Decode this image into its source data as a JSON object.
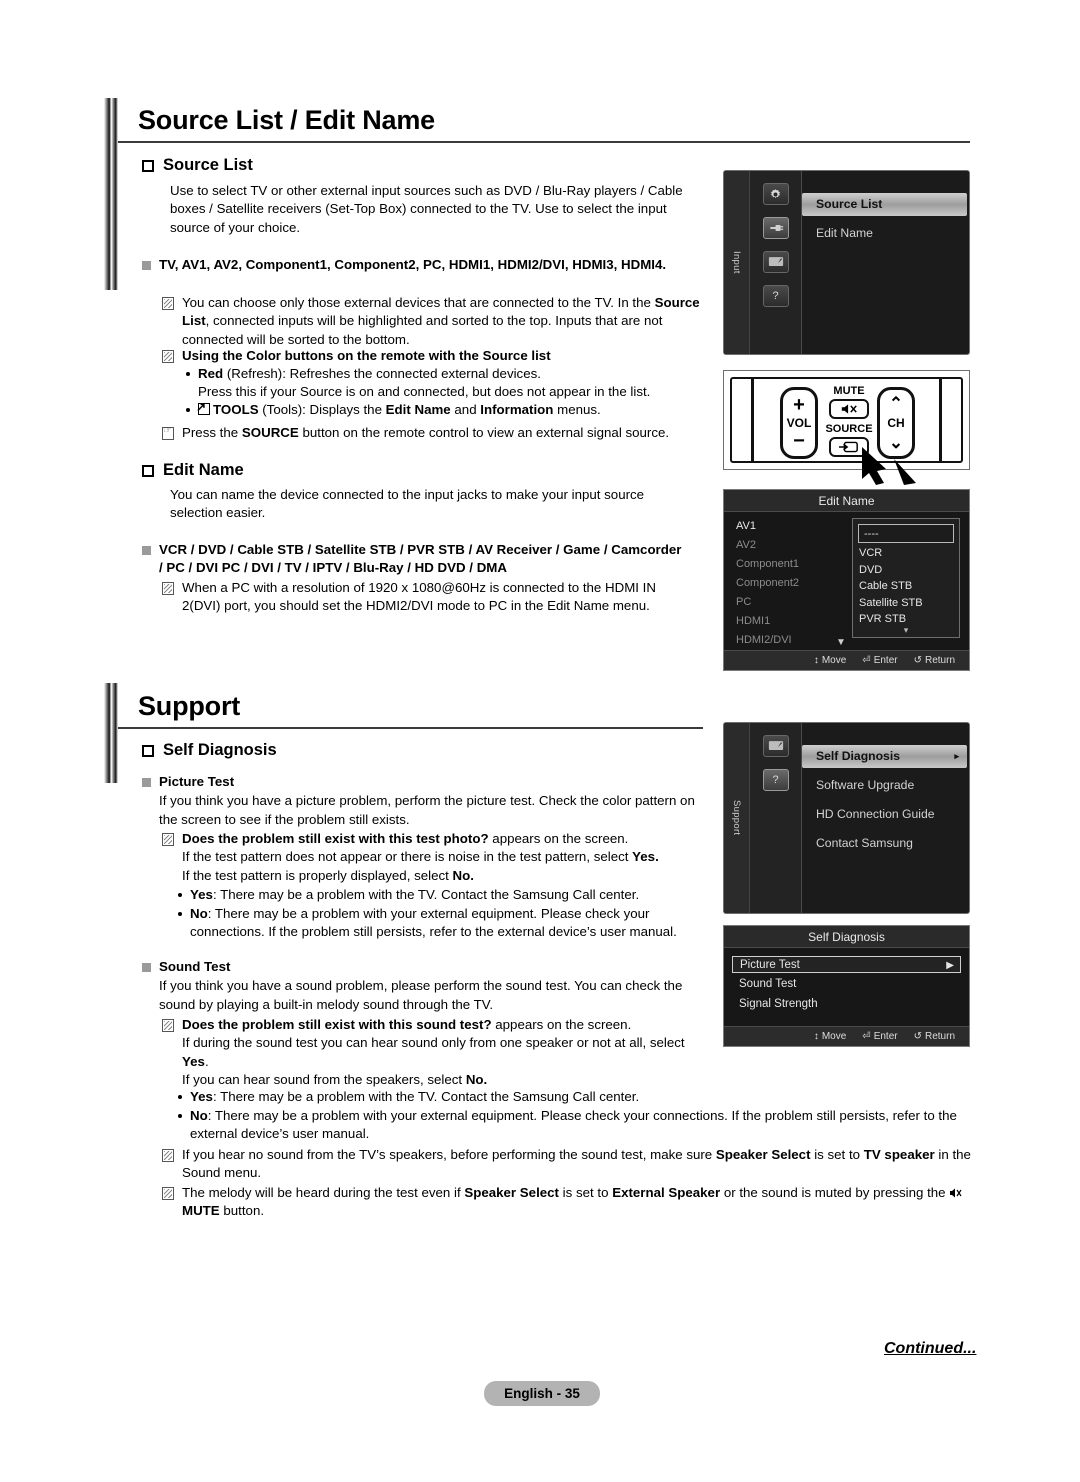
{
  "page": {
    "footer_label": "English - 35",
    "continued": "Continued..."
  },
  "chapter1": {
    "title": "Source List / Edit Name",
    "source_list": {
      "heading": "Source List",
      "body": "Use to select TV or other external input sources such as DVD / Blu-Ray players / Cable boxes / Satellite receivers (Set-Top Box) connected to the TV. Use to select the input source of your choice.",
      "inputs_heading": "TV, AV1, AV2, Component1, Component2, PC, HDMI1, HDMI2/DVI, HDMI3, HDMI4.",
      "note1_a": "You can choose only those external devices that are connected to the TV. In the ",
      "note1_b": "Source List",
      "note1_c": ", connected inputs will be highlighted and sorted to the top. Inputs that are not connected will be sorted to the bottom.",
      "note2": "Using the Color buttons on the remote with the Source list",
      "bullet_red_bold": "Red",
      "bullet_red_rest": " (Refresh): Refreshes the connected external devices.",
      "bullet_red_line2": "Press this if your Source is on and connected, but does not appear in the list.",
      "bullet_tools_bold": "TOOLS",
      "bullet_tools_mid": " (Tools): Displays the ",
      "bullet_tools_b1": "Edit Name",
      "bullet_tools_and": " and ",
      "bullet_tools_b2": "Information",
      "bullet_tools_end": " menus.",
      "hand_a": "Press the ",
      "hand_b": "SOURCE",
      "hand_c": " button on the remote control to view an external signal source."
    },
    "edit_name": {
      "heading": "Edit Name",
      "body": "You can name the device connected to the input jacks to make your input source selection easier.",
      "devices_heading": "VCR / DVD / Cable STB / Satellite STB / PVR STB / AV Receiver / Game / Camcorder / PC / DVI PC / DVI / TV / IPTV / Blu-Ray / HD DVD / DMA",
      "note": "When a PC with a resolution of 1920 x 1080@60Hz is connected to the HDMI IN 2(DVI) port, you should set the HDMI2/DVI mode to PC in the Edit Name menu."
    }
  },
  "chapter2": {
    "title": "Support",
    "self_diagnosis": {
      "heading": "Self Diagnosis",
      "picture_test": {
        "label": "Picture Test",
        "body": "If you think you have a picture problem, perform the picture test. Check the color pattern on the screen to see if the problem still exists.",
        "note_bold": "Does the problem still exist with this test photo?",
        "note_rest": " appears on the screen.",
        "note_line2_a": "If the test pattern does not appear or there is noise in the test pattern, select ",
        "note_line2_b": "Yes.",
        "note_line3_a": "If the test pattern is properly displayed, select ",
        "note_line3_b": "No.",
        "yes_bold": "Yes",
        "yes_rest": ": There may be a problem with the TV. Contact the Samsung Call center.",
        "no_bold": "No",
        "no_rest": ": There may be a problem with your external equipment. Please check your connections. If the problem still persists, refer to the external device’s user manual."
      },
      "sound_test": {
        "label": "Sound Test",
        "body": "If you think you have a sound problem, please perform the sound test. You can check the sound by playing a built-in melody sound through the TV.",
        "note_bold": "Does the problem still exist with this sound test?",
        "note_rest": " appears on the screen.",
        "note_line2_a": "If during the sound test you can hear sound only from one speaker or not at all, select ",
        "note_line2_b": "Yes",
        "note_line2_c": ".",
        "note_line3_a": "If you can hear sound from the speakers, select ",
        "note_line3_b": "No.",
        "yes_bold": "Yes",
        "yes_rest": ": There may be a problem with the TV. Contact the Samsung Call center.",
        "no_bold": "No",
        "no_rest": ": There may be a problem with your external equipment. Please check your connections. If the problem still persists, refer to the external device’s user manual.",
        "note_speaker_a": "If you hear no sound from the TV’s speakers, before performing the sound test, make sure ",
        "note_speaker_b": "Speaker Select",
        "note_speaker_c": " is set to ",
        "note_speaker_d": "TV speaker",
        "note_speaker_e": " in the Sound menu.",
        "note_melody_a": "The melody will be heard during the test even if ",
        "note_melody_b": "Speaker Select",
        "note_melody_c": " is set to ",
        "note_melody_d": "External Speaker",
        "note_melody_e": " or the sound is muted by pressing the ",
        "note_melody_f": "MUTE",
        "note_melody_g": " button."
      }
    }
  },
  "osd_input": {
    "tab_label": "Input",
    "icons": [
      "gear-icon",
      "plug-icon",
      "setup-icon",
      "question-icon"
    ],
    "items": [
      {
        "label": "Source List",
        "selected": true
      },
      {
        "label": "Edit Name",
        "selected": false
      }
    ]
  },
  "osd_edit_name": {
    "title": "Edit Name",
    "inputs": [
      {
        "label": "AV1",
        "active": true
      },
      {
        "label": "AV2",
        "active": false
      },
      {
        "label": "Component1",
        "active": false
      },
      {
        "label": "Component2",
        "active": false
      },
      {
        "label": "PC",
        "active": false
      },
      {
        "label": "HDMI1",
        "active": false
      },
      {
        "label": "HDMI2/DVI",
        "active": false
      }
    ],
    "field_value": "----",
    "options": [
      "VCR",
      "DVD",
      "Cable STB",
      "Satellite STB",
      "PVR STB"
    ],
    "footer": [
      {
        "glyph": "↕",
        "label": "Move"
      },
      {
        "glyph": "⏎",
        "label": "Enter"
      },
      {
        "glyph": "↺",
        "label": "Return"
      }
    ]
  },
  "osd_support": {
    "tab_label": "Support",
    "icons": [
      "setup-icon",
      "question-icon"
    ],
    "items": [
      {
        "label": "Self Diagnosis",
        "selected": true
      },
      {
        "label": "Software Upgrade",
        "selected": false
      },
      {
        "label": "HD Connection Guide",
        "selected": false
      },
      {
        "label": "Contact Samsung",
        "selected": false
      }
    ]
  },
  "osd_self_diagnosis": {
    "title": "Self Diagnosis",
    "rows": [
      {
        "label": "Picture Test",
        "selected": true
      },
      {
        "label": "Sound Test",
        "selected": false
      },
      {
        "label": "Signal Strength",
        "selected": false
      }
    ],
    "footer": [
      {
        "glyph": "↕",
        "label": "Move"
      },
      {
        "glyph": "⏎",
        "label": "Enter"
      },
      {
        "glyph": "↺",
        "label": "Return"
      }
    ]
  },
  "remote": {
    "vol_label": "VOL",
    "vol_plus": "+",
    "vol_minus": "−",
    "mute_label": "MUTE",
    "source_label": "SOURCE",
    "ch_label": "CH",
    "ch_up": "⌃",
    "ch_down": "⌄"
  }
}
